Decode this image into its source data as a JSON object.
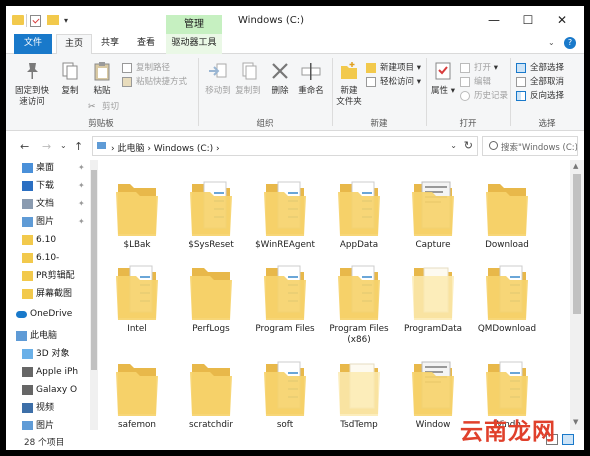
{
  "window": {
    "title": "Windows (C:)"
  },
  "context_tab_header": "管理",
  "tabs": {
    "file": "文件",
    "home": "主页",
    "share": "共享",
    "view": "查看",
    "drive_tools": "驱动器工具"
  },
  "ribbon": {
    "clipboard": {
      "label": "剪贴板",
      "pin_quick_access": "固定到快\n速访问",
      "copy": "复制",
      "paste": "粘贴",
      "copy_path": "复制路径",
      "paste_shortcut": "粘贴快捷方式",
      "cut": "剪切"
    },
    "organize": {
      "label": "组织",
      "move_to": "移动到",
      "copy_to": "复制到",
      "delete": "删除",
      "rename": "重命名"
    },
    "new": {
      "label": "新建",
      "new_folder": "新建\n文件夹",
      "new_item": "新建项目",
      "easy_access": "轻松访问"
    },
    "open": {
      "label": "打开",
      "properties": "属性",
      "open": "打开",
      "edit": "编辑",
      "history": "历史记录"
    },
    "select": {
      "label": "选择",
      "select_all": "全部选择",
      "select_none": "全部取消",
      "invert": "反向选择"
    }
  },
  "address": {
    "path_text": "›  此电脑  ›  Windows (C:)  ›",
    "search_placeholder": "搜索\"Windows (C:)\""
  },
  "nav_pane": {
    "items": [
      {
        "label": "桌面",
        "icon": "desktop-icon",
        "pinned": true
      },
      {
        "label": "下载",
        "icon": "download-icon",
        "pinned": true
      },
      {
        "label": "文档",
        "icon": "documents-icon",
        "pinned": true
      },
      {
        "label": "图片",
        "icon": "pictures-icon",
        "pinned": true
      },
      {
        "label": "6.10",
        "icon": "folder-icon",
        "pinned": false
      },
      {
        "label": "6.10-",
        "icon": "folder-icon",
        "pinned": false
      },
      {
        "label": "PR剪辑配",
        "icon": "folder-icon",
        "pinned": false
      },
      {
        "label": "屏幕截图",
        "icon": "folder-icon",
        "pinned": false
      },
      {
        "label": "OneDrive",
        "icon": "onedrive-icon",
        "pinned": false
      },
      {
        "label": "此电脑",
        "icon": "this-pc-icon",
        "pinned": false
      },
      {
        "label": "3D 对象",
        "icon": "3d-objects-icon",
        "pinned": false
      },
      {
        "label": "Apple iPh",
        "icon": "phone-icon",
        "pinned": false
      },
      {
        "label": "Galaxy O",
        "icon": "phone-icon",
        "pinned": false
      },
      {
        "label": "视频",
        "icon": "videos-icon",
        "pinned": false
      },
      {
        "label": "图片",
        "icon": "pictures-icon",
        "pinned": false
      }
    ]
  },
  "files": [
    {
      "name": "$LBak",
      "type": "empty"
    },
    {
      "name": "$SysReset",
      "type": "docs"
    },
    {
      "name": "$WinREAgent",
      "type": "docs"
    },
    {
      "name": "AppData",
      "type": "docs"
    },
    {
      "name": "Capture",
      "type": "photo"
    },
    {
      "name": "Download",
      "type": "empty"
    },
    {
      "name": "Intel",
      "type": "docs"
    },
    {
      "name": "PerfLogs",
      "type": "empty"
    },
    {
      "name": "Program Files",
      "type": "docs"
    },
    {
      "name": "Program Files (x86)",
      "type": "docs"
    },
    {
      "name": "ProgramData",
      "type": "light"
    },
    {
      "name": "QMDownload",
      "type": "docs"
    },
    {
      "name": "safemon",
      "type": "empty"
    },
    {
      "name": "scratchdir",
      "type": "empty"
    },
    {
      "name": "soft",
      "type": "docs"
    },
    {
      "name": "TsdTemp",
      "type": "light"
    },
    {
      "name": "Window",
      "type": "photo"
    },
    {
      "name": "Windo",
      "type": "docs"
    }
  ],
  "status": {
    "item_count": "28 个项目"
  },
  "watermark": "云南龙网",
  "colors": {
    "accent": "#1979ca",
    "folder": "#f2c94c",
    "context_tab": "#c6f0c1"
  }
}
